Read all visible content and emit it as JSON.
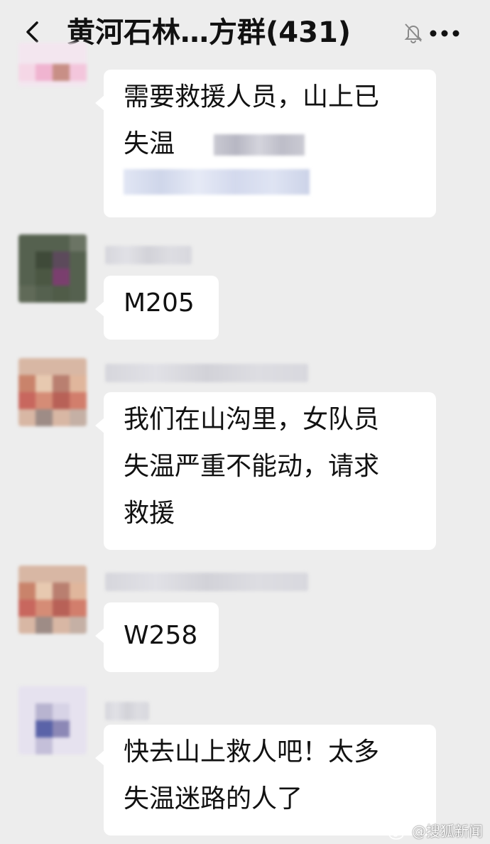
{
  "header": {
    "title": "黄河石林…方群(431)"
  },
  "messages": [
    {
      "lines": [
        "需要救援人员，山上已",
        "失温"
      ]
    },
    {
      "lines": [
        "M205"
      ]
    },
    {
      "lines": [
        "我们在山沟里，女队员",
        "失温严重不能动，请求",
        "救援"
      ]
    },
    {
      "lines": [
        "W258"
      ]
    },
    {
      "lines": [
        "快去山上救人吧！太多",
        "失温迷路的人了"
      ]
    }
  ],
  "watermark": {
    "text": "@搜狐新闻"
  }
}
